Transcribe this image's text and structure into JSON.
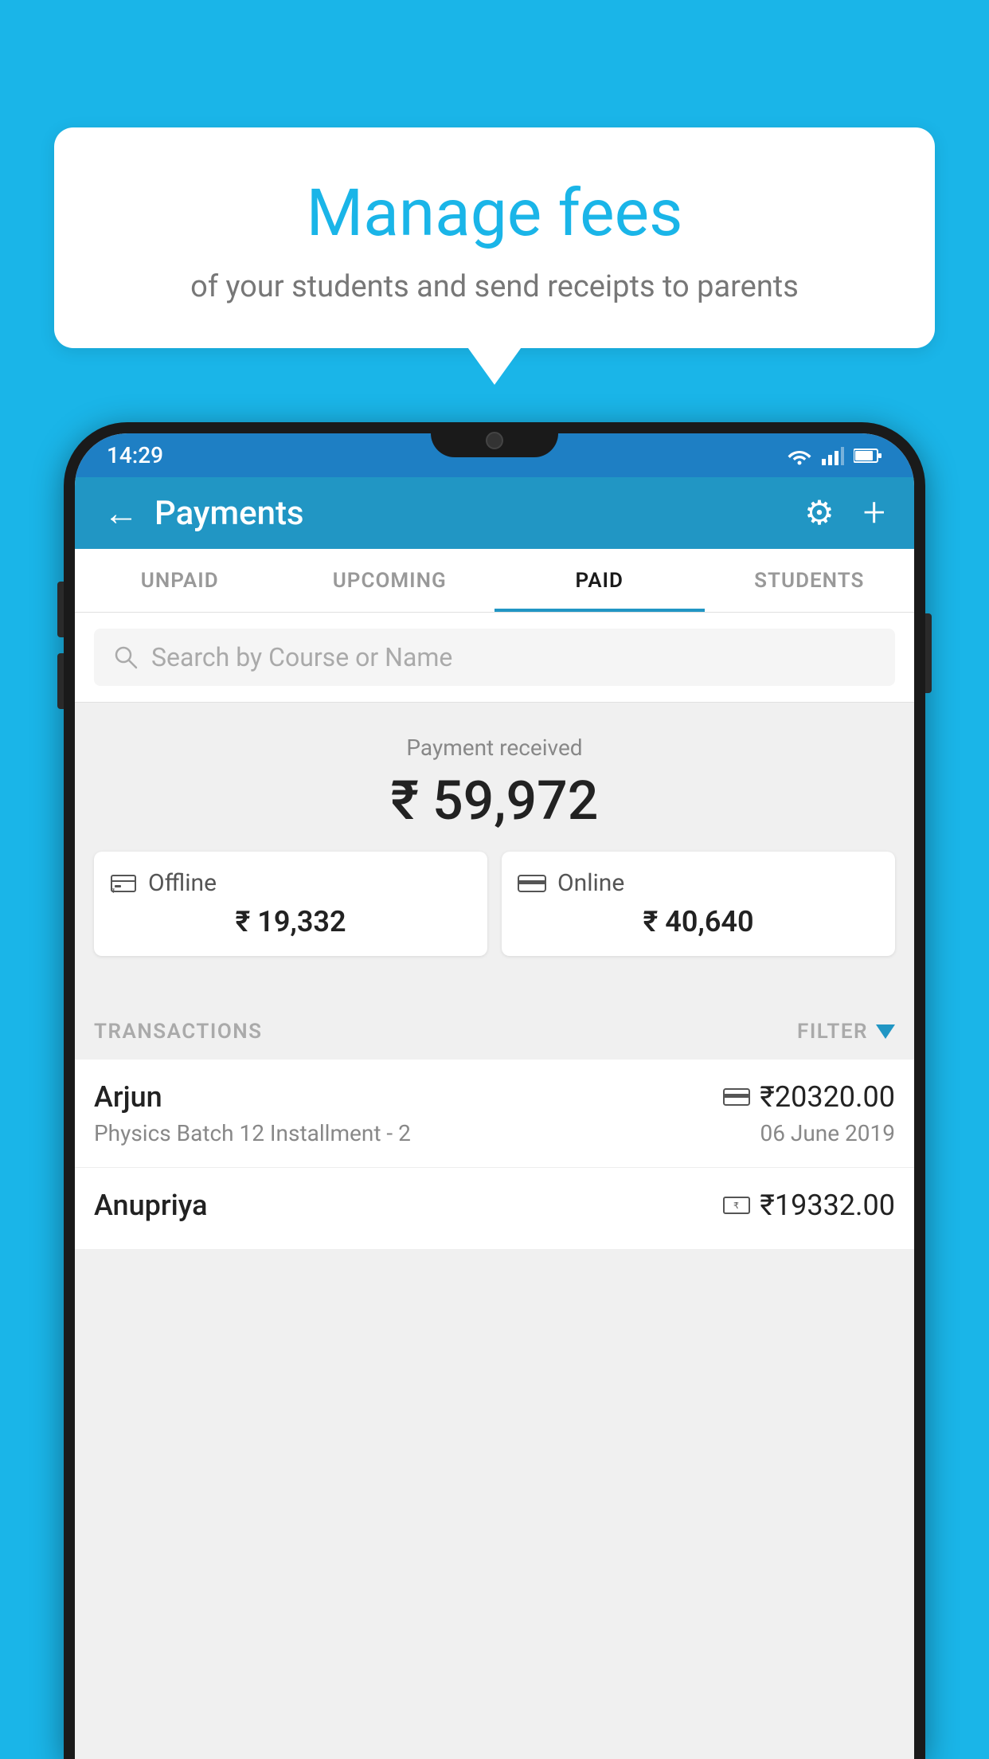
{
  "background_color": "#1ab5e8",
  "bubble": {
    "title": "Manage fees",
    "subtitle": "of your students and send receipts to parents"
  },
  "status_bar": {
    "time": "14:29",
    "icons": [
      "wifi",
      "signal",
      "battery"
    ]
  },
  "header": {
    "title": "Payments",
    "back_label": "←",
    "gear_label": "⚙",
    "plus_label": "+"
  },
  "tabs": [
    {
      "label": "UNPAID",
      "active": false
    },
    {
      "label": "UPCOMING",
      "active": false
    },
    {
      "label": "PAID",
      "active": true
    },
    {
      "label": "STUDENTS",
      "active": false
    }
  ],
  "search": {
    "placeholder": "Search by Course or Name"
  },
  "payment_summary": {
    "label": "Payment received",
    "total": "₹ 59,972",
    "offline_label": "Offline",
    "offline_amount": "₹ 19,332",
    "online_label": "Online",
    "online_amount": "₹ 40,640"
  },
  "transactions_section": {
    "label": "TRANSACTIONS",
    "filter_label": "FILTER"
  },
  "transactions": [
    {
      "name": "Arjun",
      "amount": "₹20320.00",
      "details": "Physics Batch 12 Installment - 2",
      "date": "06 June 2019",
      "payment_type": "card"
    },
    {
      "name": "Anupriya",
      "amount": "₹19332.00",
      "details": "",
      "date": "",
      "payment_type": "cash"
    }
  ]
}
